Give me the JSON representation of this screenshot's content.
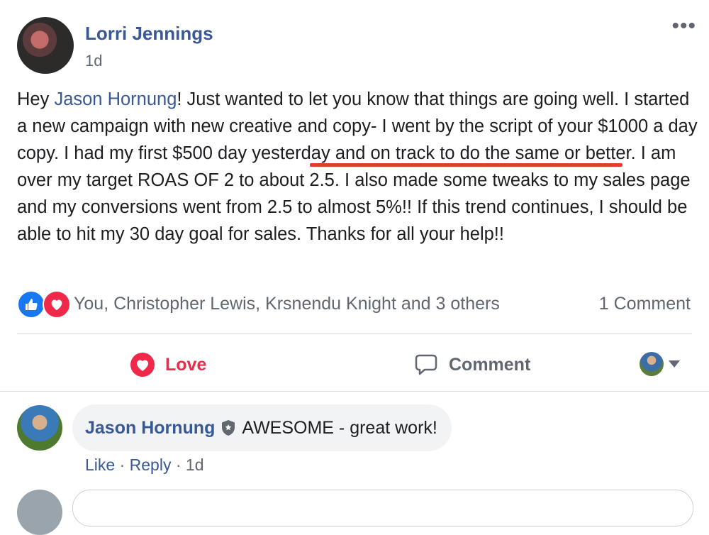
{
  "post": {
    "author": "Lorri Jennings",
    "time": "1d",
    "more_label": "•••",
    "text_before_mention": "Hey ",
    "mention": "Jason Hornung",
    "text_after_mention": "! Just wanted to let you know that things are going well. I started a new campaign with new creative and copy- I went by the script of your $1000 a day copy. I had my first $500 day yesterday and on track to do the same or better. I am over my target ROAS OF 2 to about 2.5. I also made some tweaks to my sales page and my conversions went from 2.5 to almost 5%!! If this trend continues, I should be able to hit my 30 day goal for sales. Thanks for all your help!!",
    "highlight_color": "#e0402a"
  },
  "reactions": {
    "icons": [
      "like-icon",
      "love-icon"
    ],
    "names": "You, Christopher Lewis, Krsnendu Knight and 3 others",
    "comment_count": "1 Comment"
  },
  "actions": {
    "love_label": "Love",
    "comment_label": "Comment",
    "love_color": "#f0284a"
  },
  "comment": {
    "author": "Jason Hornung",
    "text": "AWESOME - great work!",
    "like_label": "Like",
    "sep1": " · ",
    "reply_label": "Reply",
    "sep2": " · ",
    "time": "1d"
  },
  "colors": {
    "link": "#385898",
    "secondary_text": "#606770",
    "like_blue": "#1877f2"
  }
}
